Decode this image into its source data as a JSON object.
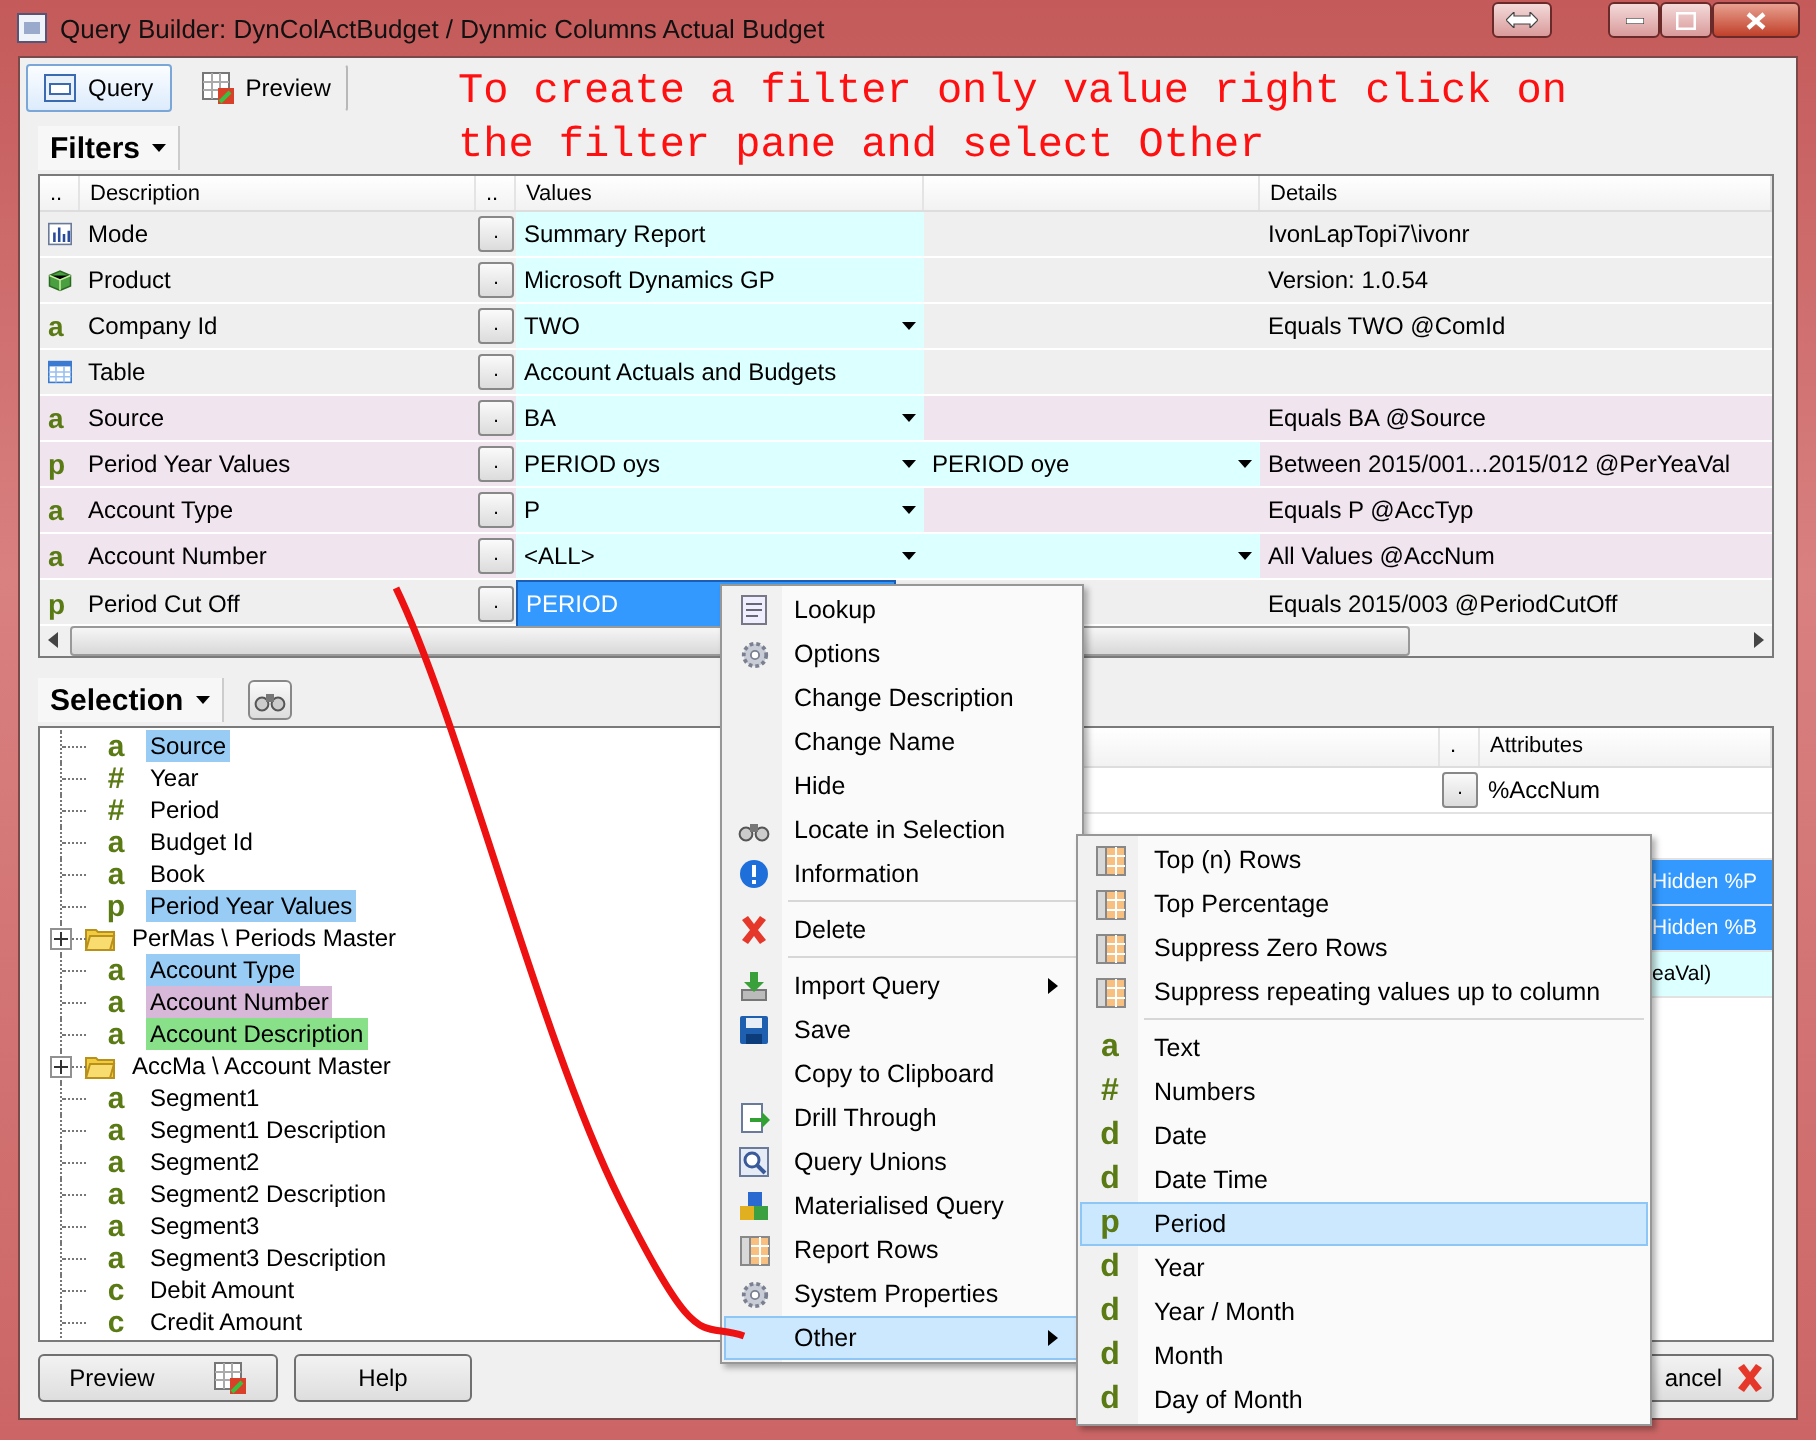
{
  "window": {
    "title": "Query Builder:  DynColActBudget / Dynmic Columns Actual Budget"
  },
  "tabs": [
    {
      "label": "Query",
      "selected": true
    },
    {
      "label": "Preview",
      "selected": false
    }
  ],
  "annotation": [
    "To create a filter only value right click on",
    "the filter pane and select Other"
  ],
  "filters": {
    "title": "Filters",
    "columns": [
      "..",
      "Description",
      "..",
      "Values",
      "Details"
    ],
    "row_button": ".",
    "rows": [
      {
        "description": "Mode",
        "value": "Summary Report",
        "dropdown": false,
        "second_field": false,
        "details": "IvonLapTopi7\\ivonr",
        "kind": "system",
        "selected": false
      },
      {
        "description": "Product",
        "value": "Microsoft Dynamics GP",
        "dropdown": false,
        "second_field": false,
        "details": "Version: 1.0.54",
        "kind": "system",
        "selected": false
      },
      {
        "glyph": "a",
        "description": "Company Id",
        "value": "TWO",
        "dropdown": true,
        "second_field": false,
        "details": "Equals TWO @ComId",
        "kind": "system",
        "selected": false
      },
      {
        "description": "Table",
        "value": "Account Actuals and Budgets",
        "dropdown": false,
        "second_field": false,
        "kind": "system",
        "selected": false
      },
      {
        "glyph": "a",
        "description": "Source",
        "value": "BA",
        "dropdown": true,
        "second_field": false,
        "details": "Equals BA @Source",
        "kind": "filter",
        "selected": false
      },
      {
        "glyph": "p",
        "description": "Period Year Values",
        "value": "PERIOD oys",
        "dropdown": true,
        "second_field": true,
        "value2": "PERIOD oye",
        "details": "Between 2015/001...2015/012 @PerYeaVal",
        "kind": "filter",
        "selected": false
      },
      {
        "glyph": "a",
        "description": "Account Type",
        "value": "P",
        "dropdown": true,
        "second_field": false,
        "details": "Equals P @AccTyp",
        "kind": "filter",
        "selected": false
      },
      {
        "glyph": "a",
        "description": "Account Number",
        "value": "<ALL>",
        "dropdown": true,
        "second_field": true,
        "details": "All Values @AccNum",
        "kind": "filter",
        "selected": false
      },
      {
        "glyph": "p",
        "description": "Period Cut Off",
        "value": "PERIOD",
        "dropdown": false,
        "second_field": false,
        "details": "Equals 2015/003 @PeriodCutOff",
        "kind": "system",
        "selected": true
      }
    ]
  },
  "selection": {
    "title": "Selection",
    "tree": [
      {
        "kind": "field",
        "glyph": "a",
        "label": "Source",
        "color": "#99ccf5"
      },
      {
        "kind": "field",
        "glyph": "#",
        "label": "Year"
      },
      {
        "kind": "field",
        "glyph": "#",
        "label": "Period"
      },
      {
        "kind": "field",
        "glyph": "a",
        "label": "Budget Id"
      },
      {
        "kind": "field",
        "glyph": "a",
        "label": "Book"
      },
      {
        "kind": "field",
        "glyph": "p",
        "label": "Period Year Values",
        "color": "#99ccf5"
      },
      {
        "kind": "folder",
        "label": "PerMas \\ Periods Master",
        "expanded": false
      },
      {
        "kind": "field",
        "glyph": "a",
        "label": "Account Type",
        "color": "#99ccf5"
      },
      {
        "kind": "field",
        "glyph": "a",
        "label": "Account Number",
        "color": "#d8b8d8"
      },
      {
        "kind": "field",
        "glyph": "a",
        "label": "Account Description",
        "color": "#88e088"
      },
      {
        "kind": "folder",
        "label": "AccMa \\ Account Master",
        "expanded": false
      },
      {
        "kind": "field",
        "glyph": "a",
        "label": "Segment1"
      },
      {
        "kind": "field",
        "glyph": "a",
        "label": "Segment1 Description"
      },
      {
        "kind": "field",
        "glyph": "a",
        "label": "Segment2"
      },
      {
        "kind": "field",
        "glyph": "a",
        "label": "Segment2 Description"
      },
      {
        "kind": "field",
        "glyph": "a",
        "label": "Segment3"
      },
      {
        "kind": "field",
        "glyph": "a",
        "label": "Segment3 Description"
      },
      {
        "kind": "field",
        "glyph": "c",
        "label": "Debit Amount"
      },
      {
        "kind": "field",
        "glyph": "c",
        "label": "Credit Amount"
      }
    ],
    "grid": {
      "columns": [
        ".",
        "Attributes"
      ],
      "row_button": ".",
      "rows": [
        {
          "attributes": "%AccNum",
          "kind": "full",
          "selected": false,
          "tinted": false
        },
        {
          "kind": "covered",
          "selected": false,
          "tinted": false
        },
        {
          "attributes": "Hidden %P",
          "kind": "partial",
          "selected": true,
          "tinted": false
        },
        {
          "attributes": "Hidden %B",
          "kind": "partial",
          "selected": true,
          "tinted": false
        },
        {
          "attributes": "eaVal)",
          "kind": "partial",
          "selected": false,
          "tinted": true
        }
      ]
    }
  },
  "buttons": [
    {
      "label": "Preview"
    },
    {
      "label": "Help"
    }
  ],
  "cancel": {
    "label": "ancel"
  },
  "menu": [
    {
      "kind": "item",
      "label": "Lookup",
      "submenu": false,
      "selected": false
    },
    {
      "kind": "item",
      "label": "Options",
      "submenu": false,
      "selected": false
    },
    {
      "kind": "item",
      "label": "Change Description",
      "submenu": false,
      "selected": false
    },
    {
      "kind": "item",
      "label": "Change Name",
      "submenu": false,
      "selected": false
    },
    {
      "kind": "item",
      "label": "Hide",
      "submenu": false,
      "selected": false
    },
    {
      "kind": "item",
      "label": "Locate in Selection",
      "submenu": false,
      "selected": false
    },
    {
      "kind": "item",
      "label": "Information",
      "submenu": false,
      "selected": false
    },
    {
      "kind": "separator"
    },
    {
      "kind": "item",
      "label": "Delete",
      "submenu": false,
      "selected": false
    },
    {
      "kind": "separator"
    },
    {
      "kind": "item",
      "label": "Import Query",
      "submenu": true,
      "selected": false
    },
    {
      "kind": "item",
      "label": "Save",
      "submenu": false,
      "selected": false
    },
    {
      "kind": "item",
      "label": "Copy to Clipboard",
      "submenu": false,
      "selected": false
    },
    {
      "kind": "item",
      "label": "Drill Through",
      "submenu": false,
      "selected": false
    },
    {
      "kind": "item",
      "label": "Query Unions",
      "submenu": false,
      "selected": false
    },
    {
      "kind": "item",
      "label": "Materialised Query",
      "submenu": false,
      "selected": false
    },
    {
      "kind": "item",
      "label": "Report Rows",
      "submenu": false,
      "selected": false
    },
    {
      "kind": "item",
      "label": "System Properties",
      "submenu": false,
      "selected": false
    },
    {
      "kind": "item",
      "label": "Other",
      "submenu": true,
      "selected": true
    }
  ],
  "submenu": [
    {
      "kind": "item",
      "label": "Top (n) Rows",
      "selected": false
    },
    {
      "kind": "item",
      "label": "Top Percentage",
      "selected": false
    },
    {
      "kind": "item",
      "label": "Suppress Zero Rows",
      "selected": false
    },
    {
      "kind": "item",
      "label": "Suppress repeating values up to column",
      "selected": false
    },
    {
      "kind": "separator"
    },
    {
      "kind": "item",
      "label": "Text",
      "glyph": "a",
      "selected": false
    },
    {
      "kind": "item",
      "label": "Numbers",
      "glyph": "#",
      "selected": false
    },
    {
      "kind": "item",
      "label": "Date",
      "glyph": "d",
      "selected": false
    },
    {
      "kind": "item",
      "label": "Date Time",
      "glyph": "d",
      "selected": false
    },
    {
      "kind": "item",
      "label": "Period",
      "glyph": "p",
      "selected": true
    },
    {
      "kind": "item",
      "label": "Year",
      "glyph": "d",
      "selected": false
    },
    {
      "kind": "item",
      "label": "Year / Month",
      "glyph": "d",
      "selected": false
    },
    {
      "kind": "item",
      "label": "Month",
      "glyph": "d",
      "selected": false
    },
    {
      "kind": "item",
      "label": "Day of Month",
      "glyph": "d",
      "selected": false
    }
  ]
}
